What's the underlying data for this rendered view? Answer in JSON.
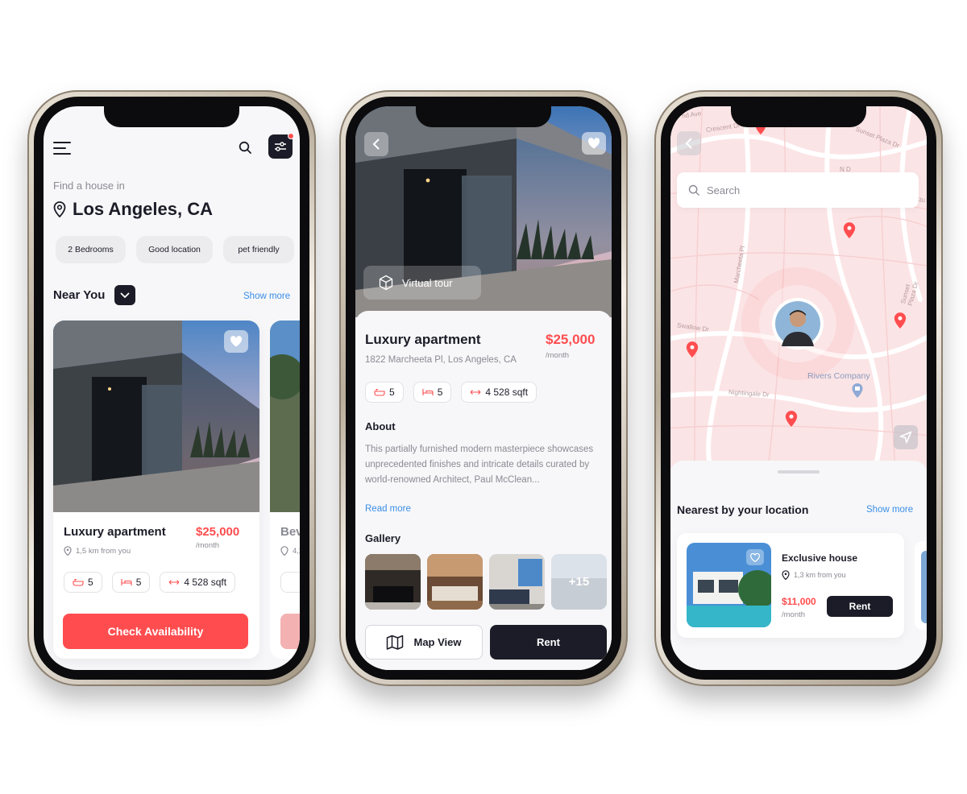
{
  "phone1": {
    "find_label": "Find a house in",
    "city": "Los Angeles, CA",
    "chips": [
      "2 Bedrooms",
      "Good location",
      "pet friendly"
    ],
    "section_title": "Near You",
    "show_more": "Show more",
    "card": {
      "title": "Luxury apartment",
      "price": "$25,000",
      "per": "/month",
      "distance": "1,5 km from you",
      "baths": "5",
      "beds": "5",
      "area": "4 528 sqft",
      "cta": "Check Availability"
    },
    "card_peek": {
      "title": "Bev",
      "distance": "4,2"
    }
  },
  "phone2": {
    "virtual_tour": "Virtual tour",
    "title": "Luxury apartment",
    "price": "$25,000",
    "per": "/month",
    "address": "1822 Marcheeta Pl, Los Angeles, CA",
    "baths": "5",
    "beds": "5",
    "area": "4 528 sqft",
    "about_title": "About",
    "about_text": "This partially furnished modern masterpiece showcases unprecedented finishes and intricate details curated by world-renowned Architect, Paul McClean...",
    "read_more": "Read more",
    "gallery_title": "Gallery",
    "gallery_more": "+15",
    "map_view": "Map View",
    "rent": "Rent"
  },
  "phone3": {
    "search_placeholder": "Search",
    "street_labels": [
      "nd Ave",
      "Crescent Dr",
      "Sunset Plaza Dr",
      "N D",
      "Marcheeta Pl",
      "Swallow Dr",
      "Sunset Plaza Dr",
      "Nightingale Dr",
      "Stu"
    ],
    "place_label": "Rivers Company",
    "section_title": "Nearest by your location",
    "show_more": "Show more",
    "card": {
      "title": "Exclusive house",
      "distance": "1,3 km from you",
      "price": "$11,000",
      "per": "/month",
      "rent": "Rent"
    }
  },
  "colors": {
    "accent": "#ff4d4f",
    "dark": "#1c1c28",
    "link": "#3a8ee6",
    "map": "#fbe4e5"
  }
}
